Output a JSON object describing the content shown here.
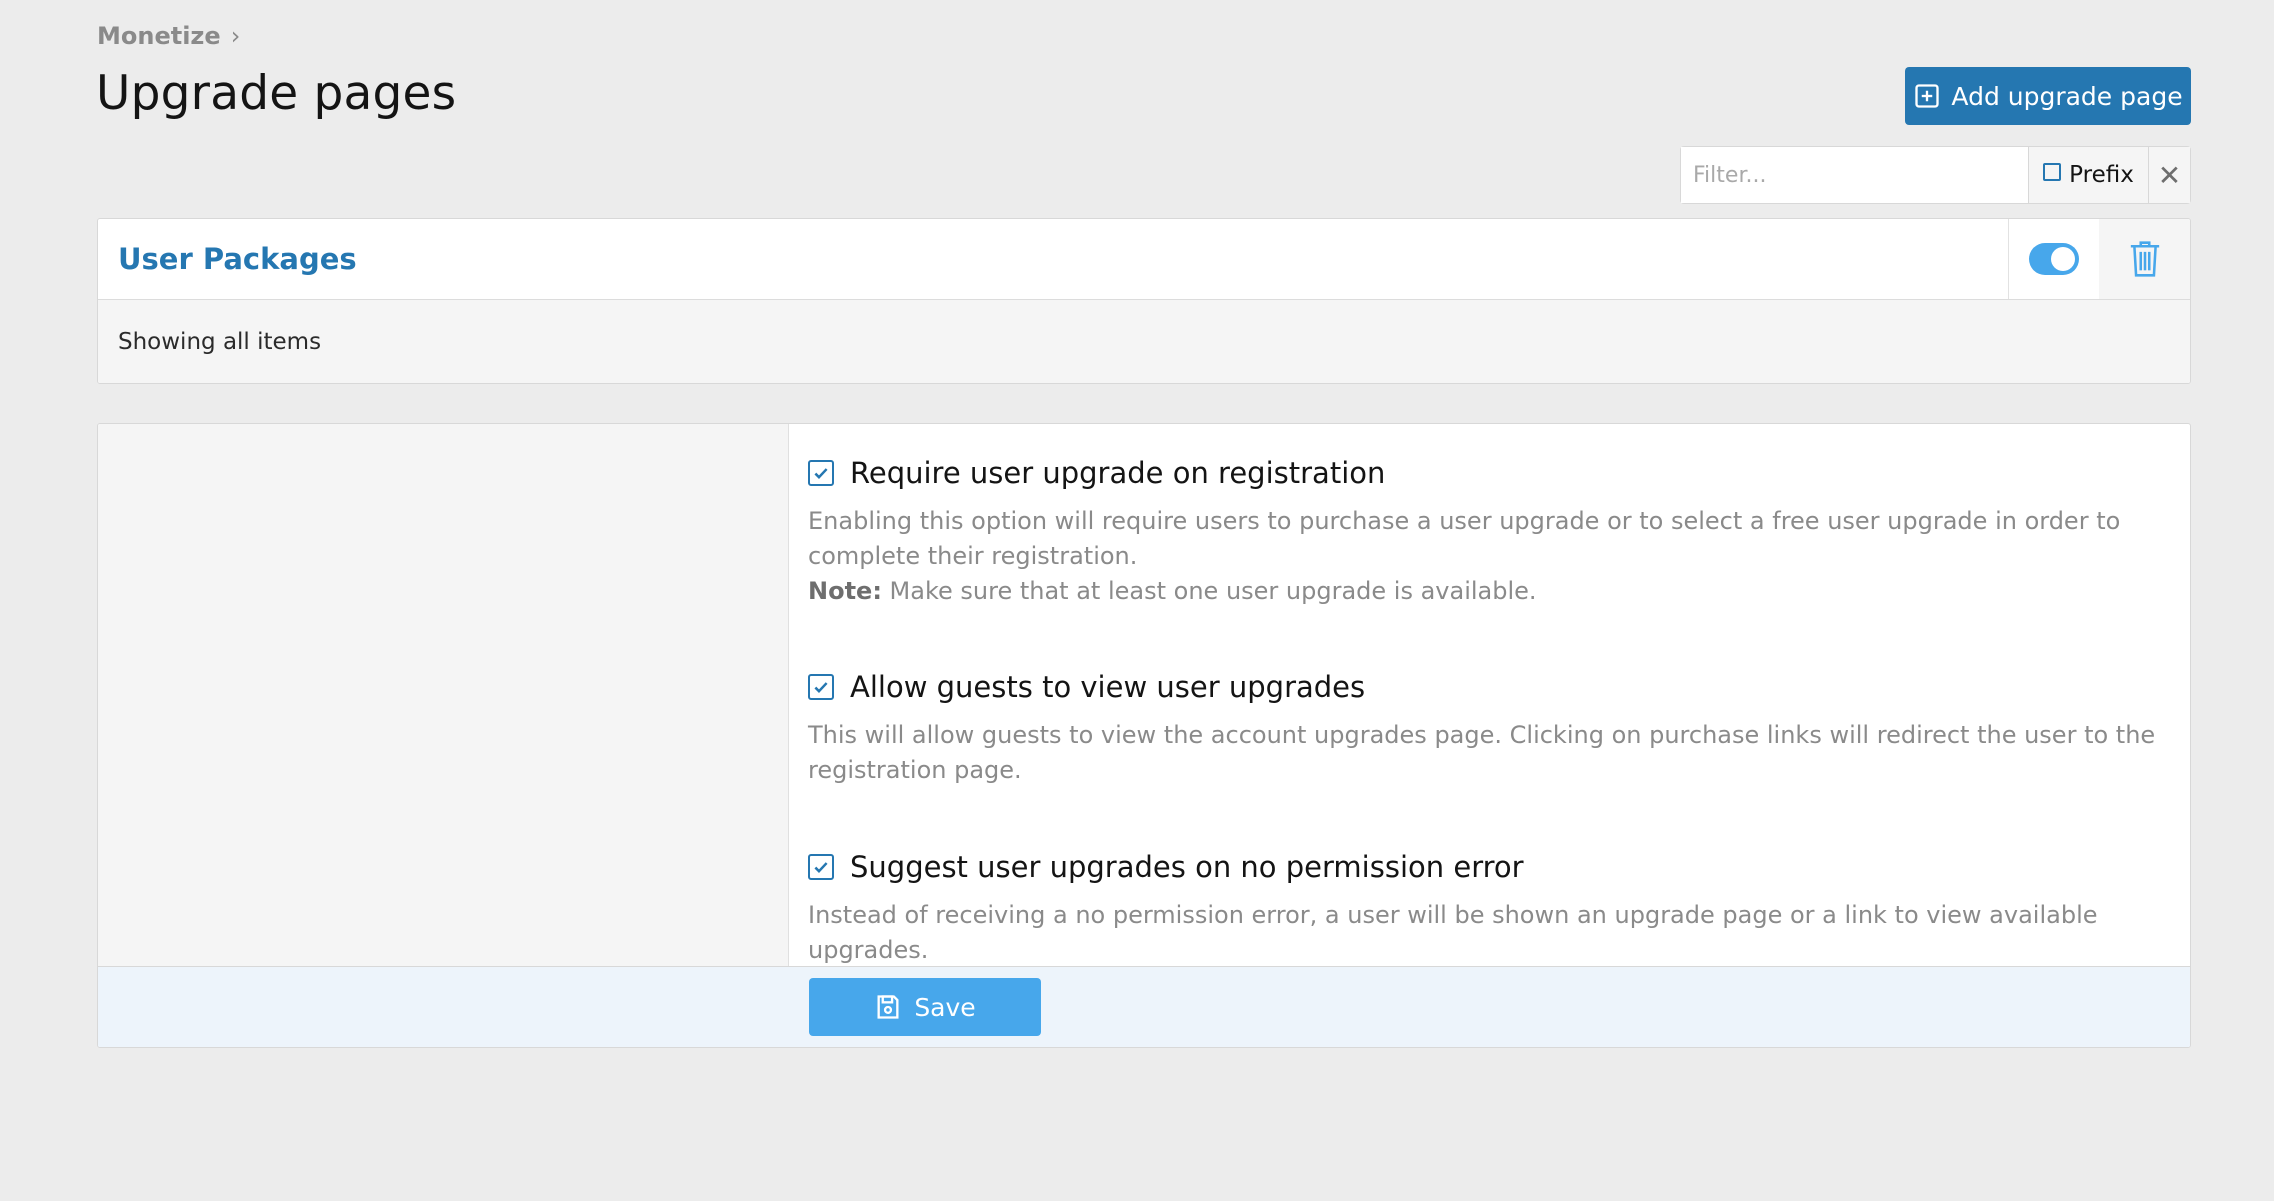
{
  "breadcrumb": {
    "label": "Monetize",
    "separator": "›"
  },
  "page_title": "Upgrade pages",
  "add_button": {
    "label": "Add upgrade page",
    "icon": "plus-square-icon"
  },
  "filter": {
    "placeholder": "Filter...",
    "value": "",
    "prefix_label": "Prefix",
    "prefix_checked": false,
    "clear_icon": "close-icon"
  },
  "block": {
    "title": "User Packages",
    "toggle_on": true,
    "delete_icon": "trash-icon",
    "footer_text": "Showing all items"
  },
  "options": [
    {
      "label": "Require user upgrade on registration",
      "checked": true,
      "description": "Enabling this option will require users to purchase a user upgrade or to select a free user upgrade in order to complete their registration.",
      "note_label": "Note:",
      "note_text": " Make sure that at least one user upgrade is available."
    },
    {
      "label": "Allow guests to view user upgrades",
      "checked": true,
      "description": "This will allow guests to view the account upgrades page. Clicking on purchase links will redirect the user to the registration page."
    },
    {
      "label": "Suggest user upgrades on no permission error",
      "checked": true,
      "description": "Instead of receiving a no permission error, a user will be shown an upgrade page or a link to view available upgrades."
    }
  ],
  "save_button": {
    "label": "Save",
    "icon": "save-icon"
  },
  "colors": {
    "accent": "#2577b1",
    "accent_light": "#47a7eb",
    "background": "#ececec"
  }
}
